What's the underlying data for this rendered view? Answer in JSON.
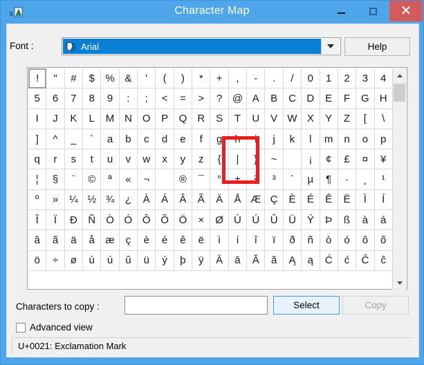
{
  "window": {
    "title": "Character Map",
    "icon": "character-map-icon",
    "minimize_label": "–",
    "maximize_label": "☐",
    "close_label": "✕"
  },
  "font_row": {
    "label": "Font :",
    "selected_font": "Arial",
    "font_icon": "truetype-icon",
    "dropdown_icon": "chevron-down-icon",
    "help_label": "Help"
  },
  "grid": {
    "columns": 20,
    "selected_index": 0,
    "rows": [
      [
        "!",
        "\"",
        "#",
        "$",
        "%",
        "&",
        "'",
        "(",
        ")",
        "*",
        "+",
        ",",
        "-",
        ".",
        "/",
        "0",
        "1",
        "2",
        "3",
        "4"
      ],
      [
        "5",
        "6",
        "7",
        "8",
        "9",
        ":",
        ";",
        "<",
        "=",
        ">",
        "?",
        "@",
        "A",
        "B",
        "C",
        "D",
        "E",
        "F",
        "G",
        "H"
      ],
      [
        "I",
        "J",
        "K",
        "L",
        "M",
        "N",
        "O",
        "P",
        "Q",
        "R",
        "S",
        "T",
        "U",
        "V",
        "W",
        "X",
        "Y",
        "Z",
        "[",
        "\\"
      ],
      [
        "]",
        "^",
        "_",
        "`",
        "a",
        "b",
        "c",
        "d",
        "e",
        "f",
        "g",
        "h",
        "i",
        "j",
        "k",
        "l",
        "m",
        "n",
        "o",
        "p"
      ],
      [
        "q",
        "r",
        "s",
        "t",
        "u",
        "v",
        "w",
        "x",
        "y",
        "z",
        "{",
        "|",
        "}",
        "~",
        " ",
        "¡",
        "¢",
        "£",
        "¤",
        "¥"
      ],
      [
        "¦",
        "§",
        "¨",
        "©",
        "ª",
        "«",
        "¬",
        "­",
        "®",
        "¯",
        "°",
        "±",
        "²",
        "³",
        "´",
        "µ",
        "¶",
        "·",
        "¸",
        "¹"
      ],
      [
        "º",
        "»",
        "¼",
        "½",
        "¾",
        "¿",
        "À",
        "Á",
        "Â",
        "Ã",
        "Ä",
        "Å",
        "Æ",
        "Ç",
        "È",
        "É",
        "Ê",
        "Ë",
        "Ì",
        "Í"
      ],
      [
        "Î",
        "Ï",
        "Ð",
        "Ñ",
        "Ò",
        "Ó",
        "Ô",
        "Õ",
        "Ö",
        "×",
        "Ø",
        "Ù",
        "Ú",
        "Û",
        "Ü",
        "Ý",
        "Þ",
        "ß",
        "à",
        "á"
      ],
      [
        "â",
        "ã",
        "ä",
        "å",
        "æ",
        "ç",
        "è",
        "é",
        "ê",
        "ë",
        "ì",
        "í",
        "î",
        "ï",
        "ð",
        "ñ",
        "ò",
        "ó",
        "ô",
        "õ"
      ],
      [
        "ö",
        "÷",
        "ø",
        "ù",
        "ú",
        "û",
        "ü",
        "ý",
        "þ",
        "ÿ",
        "Ā",
        "ā",
        "Ă",
        "ă",
        "Ą",
        "ą",
        "Ć",
        "ć",
        "Ĉ",
        "ĉ"
      ]
    ],
    "scroll_up_icon": "chevron-up-icon",
    "scroll_down_icon": "chevron-down-icon"
  },
  "annotation": {
    "shape": "red-rectangle-highlight",
    "target_character": "|",
    "color": "#ee1c1c"
  },
  "bottom": {
    "copy_label": "Characters to copy :",
    "copy_value": "",
    "copy_placeholder": "",
    "select_label": "Select",
    "copy_button_label": "Copy",
    "advanced_view_label": "Advanced view",
    "advanced_view_checked": false
  },
  "status": {
    "text": "U+0021: Exclamation Mark"
  }
}
